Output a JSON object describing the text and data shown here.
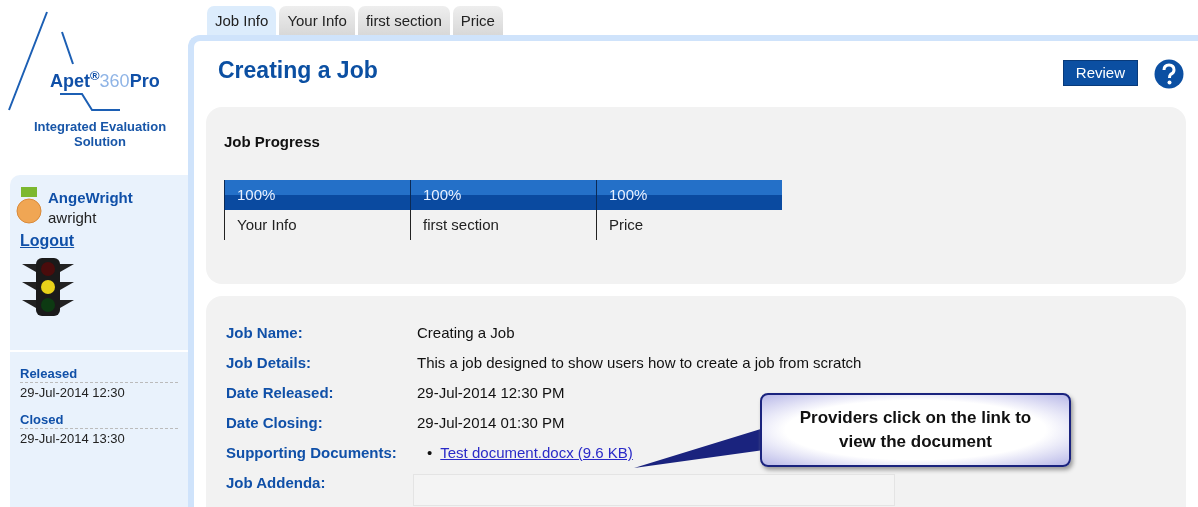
{
  "logo": {
    "wordmark": "**Apet**$^{®}$360**Pro**",
    "tagline": "Integrated Evaluation Solution"
  },
  "user": {
    "name": "AngeWright",
    "login": "awright",
    "logout": "Logout"
  },
  "dates": [
    {
      "label": "Released",
      "value": "29-Jul-2014 12:30"
    },
    {
      "label": "Closed",
      "value": "29-Jul-2014 13:30"
    }
  ],
  "tabs": [
    {
      "label": "Job Info",
      "selected": true
    },
    {
      "label": "Your Info",
      "selected": false
    },
    {
      "label": "first section",
      "selected": false
    },
    {
      "label": "Price",
      "selected": false
    }
  ],
  "page_title": "Creating a Job",
  "review_button": "Review",
  "job_progress": {
    "title": "Job Progress",
    "sections": [
      {
        "percent": "100%",
        "name": "Your Info"
      },
      {
        "percent": "100%",
        "name": "first section"
      },
      {
        "percent": "100%",
        "name": "Price"
      }
    ]
  },
  "details": [
    {
      "label": "Job Name:",
      "kind": "text",
      "value": "Creating a Job"
    },
    {
      "label": "Job Details:",
      "kind": "text",
      "value": "This a job designed to show users how to create a job from scratch"
    },
    {
      "label": "Date Released:",
      "kind": "text",
      "value": "29-Jul-2014 12:30 PM"
    },
    {
      "label": "Date Closing:",
      "kind": "text",
      "value": "29-Jul-2014 01:30 PM"
    },
    {
      "label": "Supporting Documents:",
      "kind": "links",
      "links": [
        {
          "bullet": "•",
          "text": "Test document.docx (9.6 KB)"
        }
      ]
    },
    {
      "label": "Job Addenda:",
      "kind": "field"
    }
  ],
  "callout": "Providers click on the link to view the document"
}
